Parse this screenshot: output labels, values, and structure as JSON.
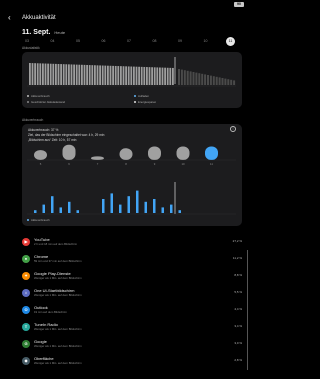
{
  "status": {
    "battery": "90"
  },
  "header": {
    "title": "Akkuaktivität"
  },
  "date": {
    "label": "11. Sept.",
    "sub": "Heute"
  },
  "day_strip": [
    "03",
    "04",
    "05",
    "06",
    "07",
    "08",
    "09",
    "10",
    "11"
  ],
  "card1": {
    "label": "Akkustatistik",
    "legend": [
      {
        "label": "Akkuverbrauch",
        "color": "#bdbdbd"
      },
      {
        "label": "Geschätzter Akkuladestand",
        "color": "#8a8a8a"
      },
      {
        "label": "Aufladen",
        "color": "#64b5f6"
      },
      {
        "label": "Energiesparen",
        "color": "#e0e0e0"
      }
    ]
  },
  "card2": {
    "label": "Akkuverbrauch",
    "summary1": "Akkuverbrauch: 37 %",
    "summary2": "Ziel, das der Bildschirm eingeschaltet war: 4 h, 29 min",
    "summary3": "„Bildschirm aus“ Zeit: 10 h, 57 min",
    "day_bars": [
      {
        "day": "5",
        "level": 0.55
      },
      {
        "day": "6",
        "level": 0.85
      },
      {
        "day": "7",
        "level": 0.2
      },
      {
        "day": "8",
        "level": 0.65
      },
      {
        "day": "9",
        "level": 0.75
      },
      {
        "day": "10",
        "level": 0.75
      },
      {
        "day": "11",
        "level": 0.75
      }
    ],
    "legend": "Akkuverbrauch"
  },
  "apps": [
    {
      "name": "YouTube",
      "detail": "2 h und 18 min auf dem Bildschirm",
      "pct": "27,2 %",
      "color": "#e53935",
      "glyph": "▶"
    },
    {
      "name": "Chrome",
      "detail": "59 min und 37 min auf dem Bildschirm",
      "pct": "11,2 %",
      "color": "#43a047",
      "glyph": "●"
    },
    {
      "name": "Google Play-Dienste",
      "detail": "Weniger als 1 Min. auf dem Bildschirm",
      "pct": "8,8 %",
      "color": "#fb8c00",
      "glyph": "✦"
    },
    {
      "name": "One UI-Startbildschirm",
      "detail": "Weniger als 1 Min. auf dem Bildschirm",
      "pct": "5,5 %",
      "color": "#5c6bc0",
      "glyph": "⌂"
    },
    {
      "name": "Outlook",
      "detail": "19 min auf dem Bildschirm",
      "pct": "4,4 %",
      "color": "#1e88e5",
      "glyph": "O"
    },
    {
      "name": "TuneIn Radio",
      "detail": "Weniger als 1 Min. auf dem Bildschirm",
      "pct": "3,4 %",
      "color": "#26a69a",
      "glyph": "T"
    },
    {
      "name": "Google",
      "detail": "Weniger als 1 Min. auf dem Bildschirm",
      "pct": "3,0 %",
      "color": "#2e7d32",
      "glyph": "G"
    },
    {
      "name": "Oberfläche",
      "detail": "Weniger als 1 Min. auf dem Bildschirm",
      "pct": "2,8 %",
      "color": "#455a64",
      "glyph": "◆"
    }
  ]
}
